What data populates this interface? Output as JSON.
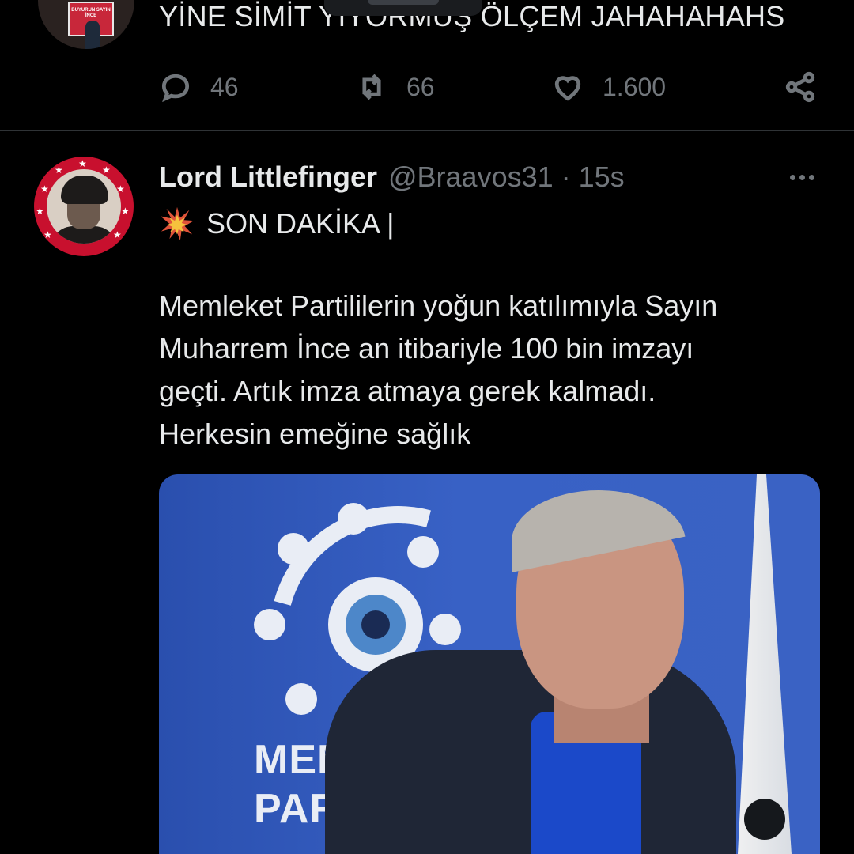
{
  "previous_tweet": {
    "text": "YİNE SİMİT YİYORMUŞ ÖLÇEM JAHAHAHAHS",
    "avatar_sign_text": "BUYURUN SAYIN İNCE",
    "actions": {
      "reply_count": "46",
      "retweet_count": "66",
      "like_count": "1.600"
    },
    "icons": [
      "reply-icon",
      "retweet-icon",
      "like-icon",
      "share-icon"
    ]
  },
  "tweet": {
    "display_name": "Lord Littlefinger",
    "handle": "@Braavos31",
    "separator": "·",
    "time": "15s",
    "headline": "SON DAKİKA |",
    "body_lines": [
      "Memleket Partililerin yoğun katılımıyla Sayın",
      "Muharrem İnce an itibariyle 100 bin imzayı",
      "geçti. Artık imza atmaya gerek kalmadı.",
      "Herkesin emeğine sağlık"
    ],
    "media_logo_lines": [
      "MEMLEKET",
      "PARTİSİ"
    ]
  },
  "colors": {
    "background": "#000000",
    "text": "#e7e9ea",
    "muted": "#71767b",
    "divider": "#2f3336",
    "avatar_ring": "#c8102e",
    "media_blue": "#3861c5"
  }
}
